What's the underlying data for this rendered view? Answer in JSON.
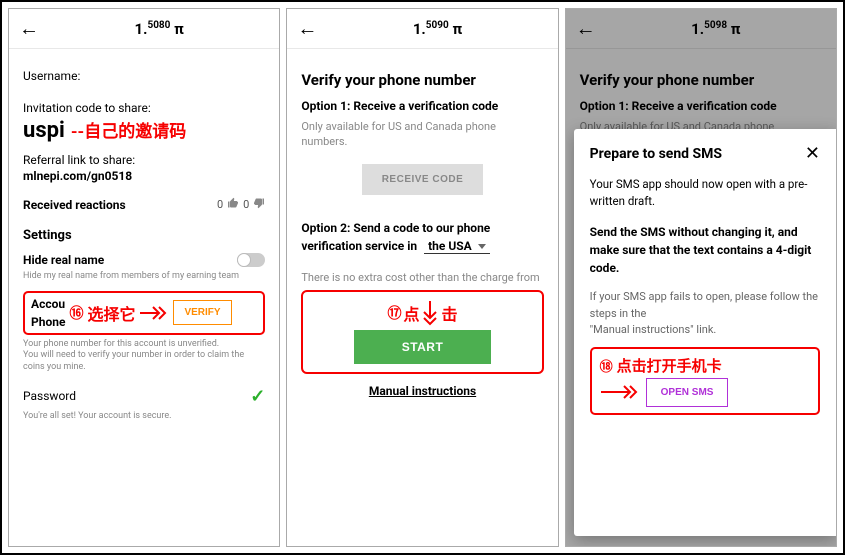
{
  "screens": [
    {
      "balance_base": "1.",
      "balance_exp": "5080",
      "balance_unit": " π"
    },
    {
      "balance_base": "1.",
      "balance_exp": "5090",
      "balance_unit": " π"
    },
    {
      "balance_base": "1.",
      "balance_exp": "5098",
      "balance_unit": " π"
    }
  ],
  "screen1": {
    "username_label": "Username:",
    "invite_label": "Invitation code to share:",
    "invite_code": "uspi",
    "invite_note": "--自己的邀请码",
    "referral_label": "Referral link to share:",
    "referral_link": "mlnepi.com/gn0518",
    "reactions_label": "Received reactions",
    "up_count": "0",
    "down_count": "0",
    "settings_label": "Settings",
    "hide_name_label": "Hide real name",
    "hide_name_hint": "Hide my real name from members of my earning team",
    "account_label": "Accou",
    "phone_label": "Phone",
    "anno_num": "⑯",
    "anno_text": "选择它",
    "verify_btn": "VERIFY",
    "phone_hint": "Your phone number for this account is unverified.\nYou will need to verify your number in order to claim the coins you mine.",
    "password_label": "Password",
    "password_hint": "You're all set! Your account is secure."
  },
  "screen2": {
    "heading": "Verify your phone number",
    "opt1_title": "Option 1: Receive a verification code",
    "opt1_desc": "Only available for US and Canada phone numbers.",
    "receive_btn": "RECEIVE CODE",
    "opt2_title_a": "Option 2: Send a code to our phone verification service in",
    "opt2_country": "the USA",
    "extra_note": "There is no extra cost other than the charge from",
    "anno_num": "⑰",
    "anno_text_a": "点",
    "anno_text_b": "击",
    "start_btn": "START",
    "manual": "Manual instructions"
  },
  "screen3": {
    "heading": "Verify your phone number",
    "opt1_title": "Option 1: Receive a verification code",
    "opt1_desc_partial": "Only available for US and Canada phone",
    "modal_title": "Prepare to send SMS",
    "modal_p1": "Your SMS app should now open with a pre-written draft.",
    "modal_bold": "Send the SMS without changing it, and make sure that the text contains a 4-digit code.",
    "modal_hint": "If your SMS app fails to open, please follow the steps in the\n\"Manual instructions\" link.",
    "anno_num": "⑱",
    "anno_text": "点击打开手机卡",
    "open_btn": "OPEN SMS",
    "bg_c": "C",
    "bg_v": "v",
    "bg_u": "U",
    "bg_n": "n"
  }
}
